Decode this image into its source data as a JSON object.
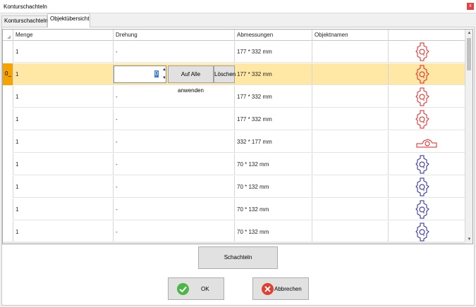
{
  "window": {
    "title": "Konturschachteln"
  },
  "tabs": [
    {
      "label": "Konturschachteln"
    },
    {
      "label": "Objektübersicht"
    }
  ],
  "grid": {
    "columns": [
      "Menge",
      "Drehung",
      "Abmessungen",
      "Objektnamen"
    ],
    "rows": [
      {
        "menge": "1",
        "drehung": "-",
        "abmessungen": "177 * 332 mm",
        "color": "#e41f1f"
      },
      {
        "menge": "1",
        "drehung": "",
        "abmessungen": "177 * 332 mm",
        "color": "#e41f1f",
        "selected": true
      },
      {
        "menge": "1",
        "drehung": "-",
        "abmessungen": "177 * 332 mm",
        "color": "#e41f1f"
      },
      {
        "menge": "1",
        "drehung": "-",
        "abmessungen": "177 * 332 mm",
        "color": "#e41f1f"
      },
      {
        "menge": "1",
        "drehung": "-",
        "abmessungen": "332 * 177 mm",
        "color": "#e41f1f",
        "rotated": true
      },
      {
        "menge": "1",
        "drehung": "-",
        "abmessungen": "70 * 132 mm",
        "color": "#23239b"
      },
      {
        "menge": "1",
        "drehung": "-",
        "abmessungen": "70 * 132 mm",
        "color": "#23239b"
      },
      {
        "menge": "1",
        "drehung": "-",
        "abmessungen": "70 * 132 mm",
        "color": "#23239b"
      },
      {
        "menge": "1",
        "drehung": "-",
        "abmessungen": "70 * 132 mm",
        "color": "#23239b"
      }
    ],
    "editor": {
      "value": "0",
      "apply_all_label": "Auf Alle anwenden",
      "delete_label": "Löschen"
    },
    "row_pointer": "0_"
  },
  "buttons": {
    "schachteln": "Schachteln",
    "ok": "OK",
    "abbrechen": "Abbrechen"
  },
  "icons": {
    "close": "close-icon",
    "ok": "check-circle-icon",
    "cancel": "x-circle-icon",
    "sort": "sort-corner-icon"
  },
  "colors": {
    "selected_row": "#ffe7a6",
    "row_header_selected": "#f5a300",
    "red_shape": "#e41f1f",
    "blue_shape": "#23239b"
  }
}
